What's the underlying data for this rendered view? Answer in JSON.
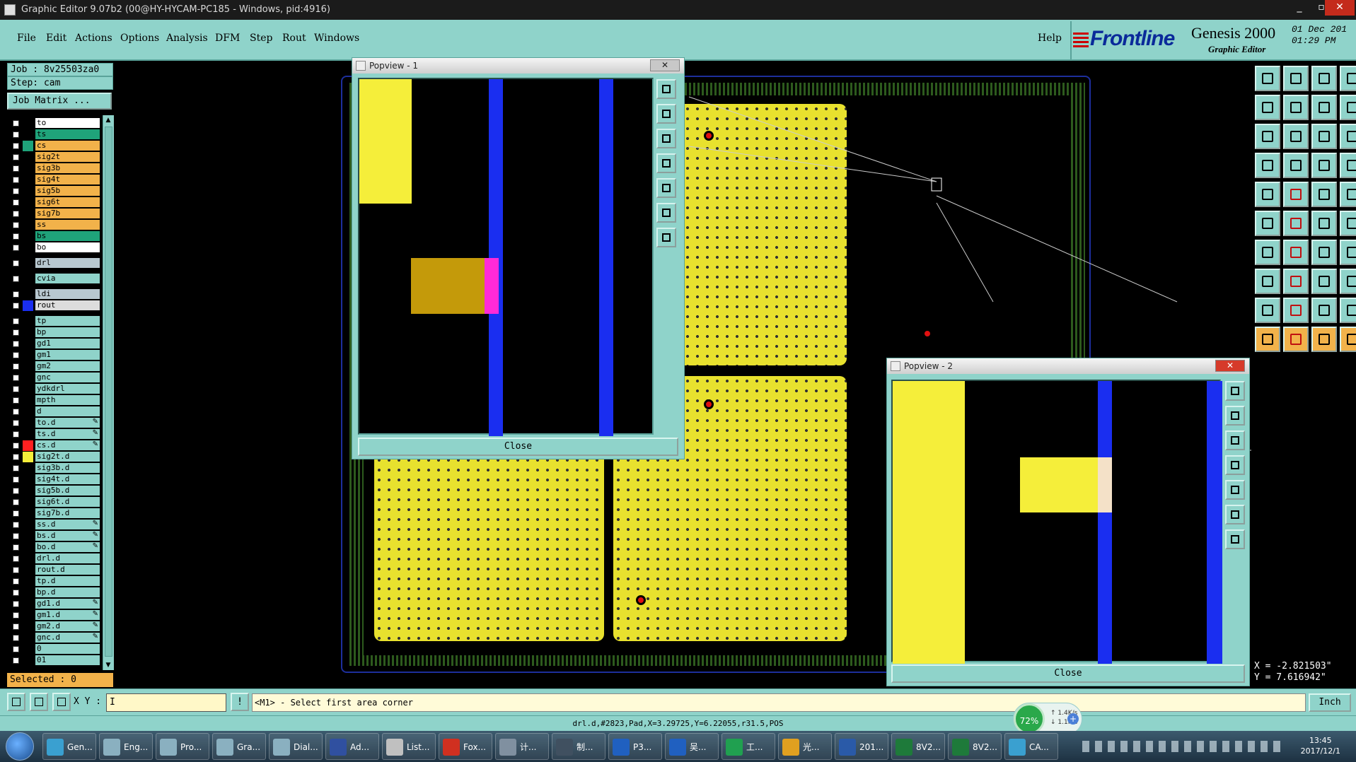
{
  "window": {
    "title": "Graphic Editor 9.07b2 (00@HY-HYCAM-PC185 - Windows, pid:4916)",
    "min": "_",
    "max": "▫",
    "close": "✕"
  },
  "menu": {
    "items": [
      "File",
      "Edit",
      "Actions",
      "Options",
      "Analysis",
      "DFM",
      "Step",
      "Rout",
      "Windows"
    ],
    "help": "Help"
  },
  "brand": {
    "logo": "Frontline",
    "product": "Genesis 2000",
    "subtitle": "Graphic Editor",
    "date": "01 Dec 201",
    "time": "01:29 PM"
  },
  "job": {
    "job_line": "Job : 8v25503za0",
    "step_line": "Step: cam",
    "matrix_button": "Job Matrix ..."
  },
  "layers": [
    {
      "name": "to",
      "color": "#ffffff"
    },
    {
      "name": "ts",
      "color": "#1fa37a"
    },
    {
      "name": "cs",
      "color": "#f2b24a"
    },
    {
      "name": "sig2t",
      "color": "#f2b24a"
    },
    {
      "name": "sig3b",
      "color": "#f2b24a"
    },
    {
      "name": "sig4t",
      "color": "#f2b24a"
    },
    {
      "name": "sig5b",
      "color": "#f2b24a"
    },
    {
      "name": "sig6t",
      "color": "#f2b24a"
    },
    {
      "name": "sig7b",
      "color": "#f2b24a"
    },
    {
      "name": "ss",
      "color": "#f2b24a"
    },
    {
      "name": "bs",
      "color": "#1fa37a"
    },
    {
      "name": "bo",
      "color": "#ffffff"
    },
    {
      "name": "drl",
      "color": "#b8c8d0"
    },
    {
      "name": "cvia",
      "color": "#8fd3ca"
    },
    {
      "name": "ldi",
      "color": "#b8c8d0"
    },
    {
      "name": "rout",
      "color": "#dcdcdc"
    },
    {
      "name": "tp",
      "color": "#8fd3ca"
    },
    {
      "name": "bp",
      "color": "#8fd3ca"
    },
    {
      "name": "gd1",
      "color": "#8fd3ca"
    },
    {
      "name": "gm1",
      "color": "#8fd3ca"
    },
    {
      "name": "gm2",
      "color": "#8fd3ca"
    },
    {
      "name": "gnc",
      "color": "#8fd3ca"
    },
    {
      "name": "ydkdrl",
      "color": "#8fd3ca"
    },
    {
      "name": "mpth",
      "color": "#8fd3ca"
    },
    {
      "name": "d",
      "color": "#8fd3ca"
    },
    {
      "name": "to.d",
      "color": "#8fd3ca",
      "edit": "✎"
    },
    {
      "name": "ts.d",
      "color": "#8fd3ca",
      "edit": "✎"
    },
    {
      "name": "cs.d",
      "color": "#8fd3ca",
      "edit": "✎"
    },
    {
      "name": "sig2t.d",
      "color": "#8fd3ca"
    },
    {
      "name": "sig3b.d",
      "color": "#8fd3ca"
    },
    {
      "name": "sig4t.d",
      "color": "#8fd3ca"
    },
    {
      "name": "sig5b.d",
      "color": "#8fd3ca"
    },
    {
      "name": "sig6t.d",
      "color": "#8fd3ca"
    },
    {
      "name": "sig7b.d",
      "color": "#8fd3ca"
    },
    {
      "name": "ss.d",
      "color": "#8fd3ca",
      "edit": "✎"
    },
    {
      "name": "bs.d",
      "color": "#8fd3ca",
      "edit": "✎"
    },
    {
      "name": "bo.d",
      "color": "#8fd3ca",
      "edit": "✎"
    },
    {
      "name": "drl.d",
      "color": "#8fd3ca"
    },
    {
      "name": "rout.d",
      "color": "#8fd3ca"
    },
    {
      "name": "tp.d",
      "color": "#8fd3ca"
    },
    {
      "name": "bp.d",
      "color": "#8fd3ca"
    },
    {
      "name": "gd1.d",
      "color": "#8fd3ca",
      "edit": "✎"
    },
    {
      "name": "gm1.d",
      "color": "#8fd3ca",
      "edit": "✎"
    },
    {
      "name": "gm2.d",
      "color": "#8fd3ca",
      "edit": "✎"
    },
    {
      "name": "gnc.d",
      "color": "#8fd3ca",
      "edit": "✎"
    },
    {
      "name": "0",
      "color": "#8fd3ca"
    },
    {
      "name": "01",
      "color": "#8fd3ca"
    }
  ],
  "selected_label": "Selected : 0",
  "popview1": {
    "title": "Popview - 1",
    "close": "Close"
  },
  "popview2": {
    "title": "Popview - 2",
    "close": "Close"
  },
  "coords": {
    "x": "X = -2.821503\"",
    "y": "Y = 7.616942\""
  },
  "command": {
    "xy_label": "X Y :",
    "xy_value": "I",
    "prompt": "<M1> - Select first area corner",
    "units": "Inch"
  },
  "status": "drl.d,#2823,Pad,X=3.29725,Y=6.22055,r31.5,POS",
  "netmeter": {
    "percent": "72%",
    "up": "1.4K/s",
    "down": "1.1K/s"
  },
  "taskbar": {
    "items": [
      "Gen...",
      "Eng...",
      "Pro...",
      "Gra...",
      "Dial...",
      "Ad...",
      "List...",
      "Fox...",
      "计...",
      "制...",
      "P3...",
      "吴...",
      "工...",
      "光...",
      "201...",
      "8V2...",
      "8V2...",
      "CA..."
    ],
    "clock_time": "13:45",
    "clock_date": "2017/12/1"
  }
}
